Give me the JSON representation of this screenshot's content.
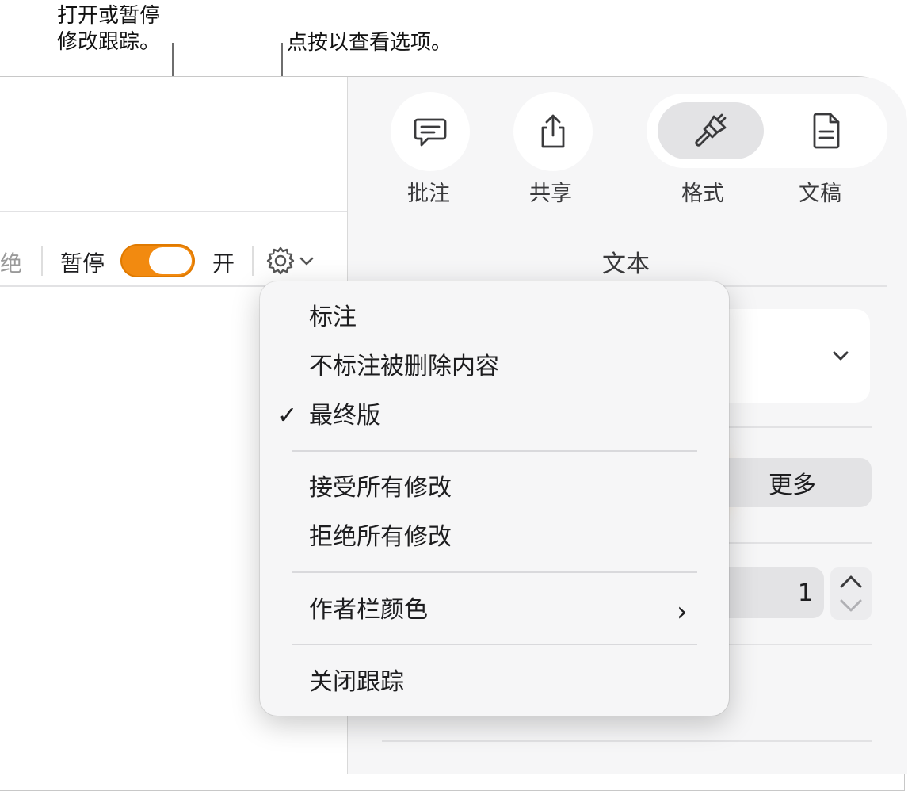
{
  "callouts": {
    "toggle_note": "打开或暂停\n修改跟踪。",
    "gear_note": "点按以查看选项。"
  },
  "toolbar": {
    "reject_partial": "绝",
    "pause_label": "暂停",
    "on_label": "开",
    "toggle_state": "on"
  },
  "inspector": {
    "tools": [
      {
        "label": "批注",
        "icon": "comment-icon"
      },
      {
        "label": "共享",
        "icon": "share-icon"
      },
      {
        "label": "格式",
        "icon": "paintbrush-icon"
      },
      {
        "label": "文稿",
        "icon": "document-icon"
      }
    ],
    "active_tool": "格式",
    "panel_title": "文本",
    "more_button": "更多",
    "number_value": "1"
  },
  "menu": {
    "items": [
      {
        "label": "标注",
        "checked": false
      },
      {
        "label": "不标注被删除内容",
        "checked": false
      },
      {
        "label": "最终版",
        "checked": true
      },
      {
        "label": "接受所有修改"
      },
      {
        "label": "拒绝所有修改"
      },
      {
        "label": "作者栏颜色",
        "submenu": true
      },
      {
        "label": "关闭跟踪"
      }
    ],
    "check_glyph": "✓",
    "submenu_glyph": "›"
  },
  "colors": {
    "accent_orange": "#f28a10",
    "panel_bg": "#f6f6f7",
    "menu_bg": "#f6f6f7"
  }
}
